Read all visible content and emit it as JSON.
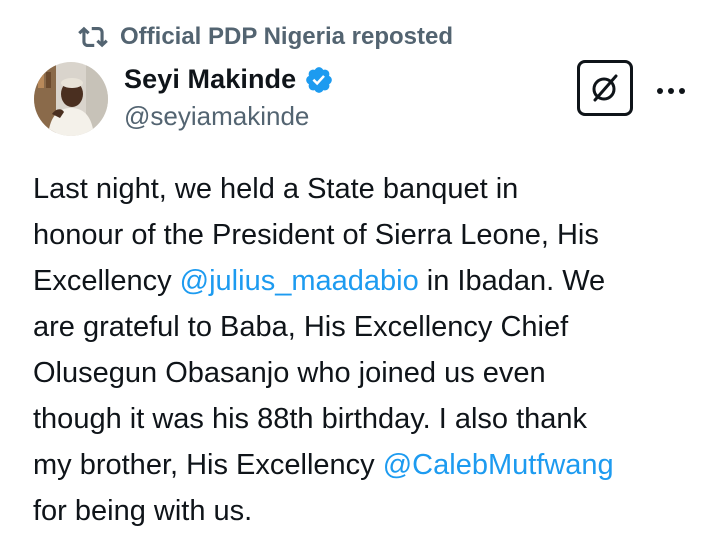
{
  "repost": {
    "icon": "repost-icon",
    "label": "Official PDP Nigeria reposted"
  },
  "author": {
    "avatar": "avatar",
    "display_name": "Seyi Makinde",
    "handle": "@seyiamakinde",
    "verified_icon": "verified-badge-icon",
    "verified_color": "#1d9bf0"
  },
  "actions": {
    "grok_icon": "grok-icon",
    "more_icon": "more-options-icon"
  },
  "tweet": {
    "l1": "Last night, we held a State banquet in",
    "l2": "honour of the President of Sierra Leone, His",
    "l3_a": "Excellency ",
    "l3_mention": "@julius_maadabio",
    "l3_b": " in Ibadan. We",
    "l4": "are grateful to Baba, His Excellency Chief",
    "l5": "Olusegun Obasanjo who joined us even",
    "l6": "though it was his 88th birthday. I also thank",
    "l7_a": "my brother, His Excellency ",
    "l7_mention": "@CalebMutfwang",
    "l8": "for being with us."
  },
  "colors": {
    "text": "#0f1419",
    "secondary": "#536471",
    "link": "#1d9bf0"
  }
}
